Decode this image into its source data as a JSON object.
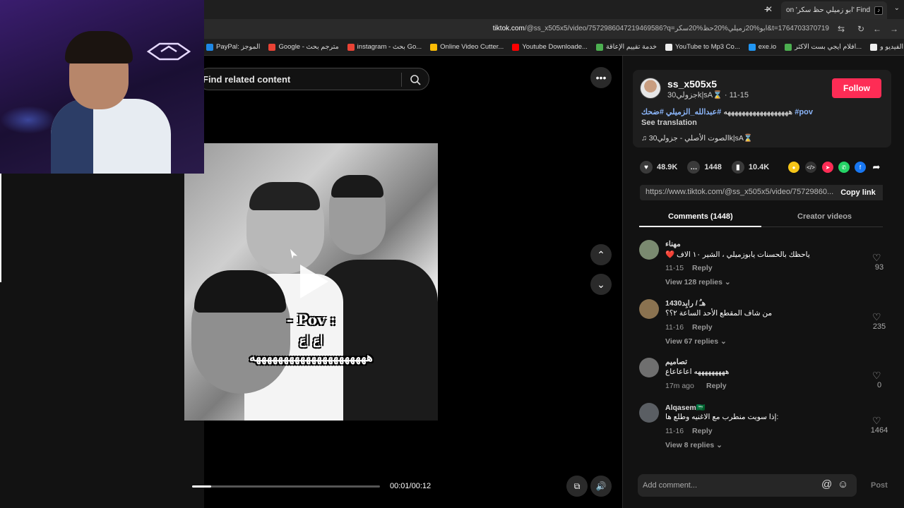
{
  "browser": {
    "tab_title": "Find 'ابو زميلي حظ سكر' on",
    "new_tab": "+",
    "url_domain": "tiktok.com",
    "url_rest": "/@ss_x505x5/video/7572986047219469586?q=ابو%20زميلي%20حظ%20سكر&t=1764703370719",
    "bookmarks": [
      {
        "label": "PayPal: الموجز",
        "color": "#1e88e5"
      },
      {
        "label": "Google - مترجم بحث",
        "color": "#ea4335"
      },
      {
        "label": "instagram - بحث Go...",
        "color": "#ea4335"
      },
      {
        "label": "Online Video Cutter...",
        "color": "#fbbc05"
      },
      {
        "label": "Youtube Downloade...",
        "color": "#ff0000"
      },
      {
        "label": "خدمة تقييم الإعاقة",
        "color": "#4caf50"
      },
      {
        "label": "YouTube to Mp3 Co...",
        "color": "#eeeeee"
      },
      {
        "label": "exe.io",
        "color": "#2196f3"
      },
      {
        "label": "افلام ايجي بست الاكثر...",
        "color": "#4caf50"
      },
      {
        "label": "تحويل ملفات الفيديو و...",
        "color": "#eeeeee"
      }
    ]
  },
  "search": {
    "placeholder": "Find related content"
  },
  "video": {
    "caption_line1": "- Pov :",
    "caption_line2": "اع اع",
    "caption_line3": "هههههههههههههههههههههه",
    "time": "00:01/00:12",
    "progress": 0.1
  },
  "author": {
    "username": "ss_x505x5",
    "display": "جزولي30k|sA⌛ · 11-15",
    "follow": "Follow",
    "desc_text": "ههههههههههههههههههه",
    "tags": [
      "#عبدالله_الزميلي",
      "#ضحك",
      "#pov"
    ],
    "see_translation": "See translation",
    "music": "♫  الصوت الأصلي - جزولي30k|sA⌛"
  },
  "actions": {
    "likes": "48.9K",
    "comments": "1448",
    "saves": "10.4K"
  },
  "link": {
    "url": "https://www.tiktok.com/@ss_x505x5/video/75729860...",
    "copy": "Copy link"
  },
  "tabs": {
    "comments": "Comments (1448)",
    "creator": "Creator videos"
  },
  "comments": [
    {
      "name": "مهناء",
      "text": "❤️ ياحظك بالحسنات يابوزميلي ، الشير ١٠ الاف",
      "date": "11-15",
      "reply": "Reply",
      "view": "View 128 replies ⌄",
      "likes": "93",
      "avatar": "#7a8a70"
    },
    {
      "name": "هـُ / رابِد1430",
      "text": "من شاف المقطع الأحد الساعة ٢؟؟",
      "date": "11-16",
      "reply": "Reply",
      "view": "View 67 replies ⌄",
      "likes": "235",
      "avatar": "#8a7250"
    },
    {
      "name": "تصاميم",
      "text": "هههههههههه اعاعاعاع",
      "date": "17m ago",
      "reply": "Reply",
      "view": "",
      "likes": "0",
      "avatar": "#6f6f6f"
    },
    {
      "name": "Alqasem🇸🇦",
      "text": "إذا سويت منطرب مع الاغنيه وطلع ها:",
      "date": "11-16",
      "reply": "Reply",
      "view": "View 8 replies ⌄",
      "likes": "1464",
      "avatar": "#5a5e63"
    }
  ],
  "add_comment": {
    "placeholder": "Add comment...",
    "post": "Post"
  }
}
